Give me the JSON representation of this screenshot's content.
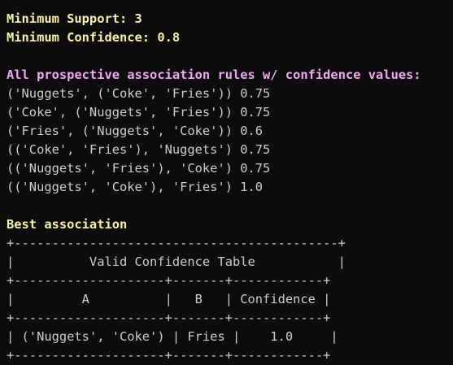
{
  "terminal": {
    "partial_line": "",
    "min_support": "Minimum Support: 3",
    "min_confidence": "Minimum Confidence: 0.8",
    "rules_heading": "All prospective association rules w/ confidence values:",
    "rules": [
      "('Nuggets', ('Coke', 'Fries')) 0.75",
      "('Coke', ('Nuggets', 'Fries')) 0.75",
      "('Fries', ('Nuggets', 'Coke')) 0.6",
      "(('Coke', 'Fries'), 'Nuggets') 0.75",
      "(('Nuggets', 'Fries'), 'Coke') 0.75",
      "(('Nuggets', 'Coke'), 'Fries') 1.0"
    ],
    "best_heading": "Best association",
    "table": {
      "border_top": "+-------------------------------------------+",
      "title_row": "|          Valid Confidence Table           |",
      "border_mid": "+--------------------+-------+------------+",
      "header_row": "|         A          |   B   | Confidence |",
      "border_hdr": "+--------------------+-------+------------+",
      "data_row": "| ('Nuggets', 'Coke') | Fries |    1.0     |",
      "border_bottom": "+--------------------+-------+------------+"
    }
  },
  "colors": {
    "background": "#0c0c0c",
    "text": "#cccccc",
    "yellow": "#f9f1a5",
    "magenta": "#f2a7f2"
  }
}
